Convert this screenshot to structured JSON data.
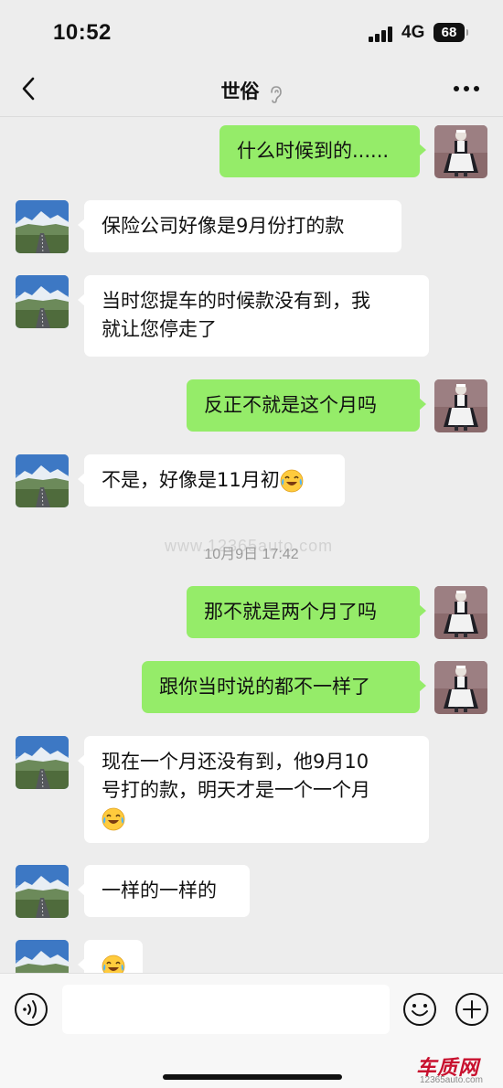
{
  "status_bar": {
    "time": "10:52",
    "network": "4G",
    "battery": "68"
  },
  "header": {
    "title": "世俗",
    "title_icon": "ear-icon",
    "back_icon": "chevron-left-icon",
    "more_icon": "more-icon"
  },
  "messages": [
    {
      "side": "right",
      "text": "什么时候到的......"
    },
    {
      "side": "left",
      "text": "保险公司好像是9月份打的款"
    },
    {
      "side": "left",
      "text": "当时您提车的时候款没有到，我\n就让您停走了"
    },
    {
      "side": "right",
      "text": "反正不就是这个月吗"
    },
    {
      "side": "left",
      "text": "不是，好像是11月初",
      "emoji": "laugh-cry-emoji"
    },
    {
      "timestamp": "10月9日 17:42"
    },
    {
      "side": "right",
      "text": "那不就是两个月了吗"
    },
    {
      "side": "right",
      "text": "跟你当时说的都不一样了"
    },
    {
      "side": "left",
      "text": "现在一个月还没有到，他9月10\n号打的款，明天才是一个一个月",
      "emoji": "laugh-cry-emoji"
    },
    {
      "side": "left",
      "text": "一样的一样的"
    },
    {
      "side": "left",
      "text": "",
      "emoji": "laugh-cry-emoji"
    }
  ],
  "watermark": "www.12365auto.com",
  "input_bar": {
    "voice_icon": "voice-icon",
    "emoji_icon": "emoji-icon",
    "plus_icon": "plus-icon"
  },
  "brand": {
    "name": "车质网",
    "url": "12365auto.com"
  },
  "colors": {
    "background": "#ededed",
    "outgoing_bubble": "#95ec69",
    "incoming_bubble": "#ffffff"
  }
}
